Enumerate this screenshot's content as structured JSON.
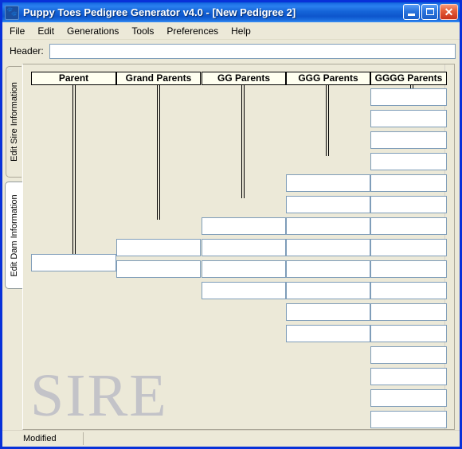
{
  "window": {
    "title": "Puppy Toes Pedigree Generator v4.0  - [New Pedigree 2]",
    "icon": "paw-icon",
    "minimize_label": "Minimize",
    "maximize_label": "Maximize",
    "close_label": "Close",
    "close_glyph": "✕",
    "accent_color": "#0831d9",
    "face_color": "#ece9d8"
  },
  "menubar": {
    "items": [
      {
        "label": "File"
      },
      {
        "label": "Edit"
      },
      {
        "label": "Generations"
      },
      {
        "label": "Tools"
      },
      {
        "label": "Preferences"
      },
      {
        "label": "Help"
      }
    ]
  },
  "header": {
    "label": "Header:",
    "value": "",
    "placeholder": ""
  },
  "side_tabs": [
    {
      "label": "Edit Sire Information",
      "selected": false
    },
    {
      "label": "Edit Dam Information",
      "selected": true
    }
  ],
  "pedigree": {
    "watermark": "SIRE",
    "watermark_color": "#c3c3c8",
    "columns": [
      {
        "header": "Parent",
        "generation": 1,
        "boxes": [
          {
            "value": ""
          }
        ]
      },
      {
        "header": "Grand Parents",
        "generation": 2,
        "boxes": [
          {
            "value": ""
          },
          {
            "value": ""
          }
        ]
      },
      {
        "header": "GG Parents",
        "generation": 3,
        "boxes": [
          {
            "value": ""
          },
          {
            "value": ""
          },
          {
            "value": ""
          },
          {
            "value": ""
          }
        ]
      },
      {
        "header": "GGG Parents",
        "generation": 4,
        "boxes": [
          {
            "value": ""
          },
          {
            "value": ""
          },
          {
            "value": ""
          },
          {
            "value": ""
          },
          {
            "value": ""
          },
          {
            "value": ""
          },
          {
            "value": ""
          },
          {
            "value": ""
          }
        ]
      },
      {
        "header": "GGGG Parents",
        "generation": 5,
        "boxes": [
          {
            "value": ""
          },
          {
            "value": ""
          },
          {
            "value": ""
          },
          {
            "value": ""
          },
          {
            "value": ""
          },
          {
            "value": ""
          },
          {
            "value": ""
          },
          {
            "value": ""
          },
          {
            "value": ""
          },
          {
            "value": ""
          },
          {
            "value": ""
          },
          {
            "value": ""
          },
          {
            "value": ""
          },
          {
            "value": ""
          },
          {
            "value": ""
          },
          {
            "value": ""
          }
        ]
      }
    ]
  },
  "statusbar": {
    "pane1": "Modified",
    "pane2": ""
  }
}
